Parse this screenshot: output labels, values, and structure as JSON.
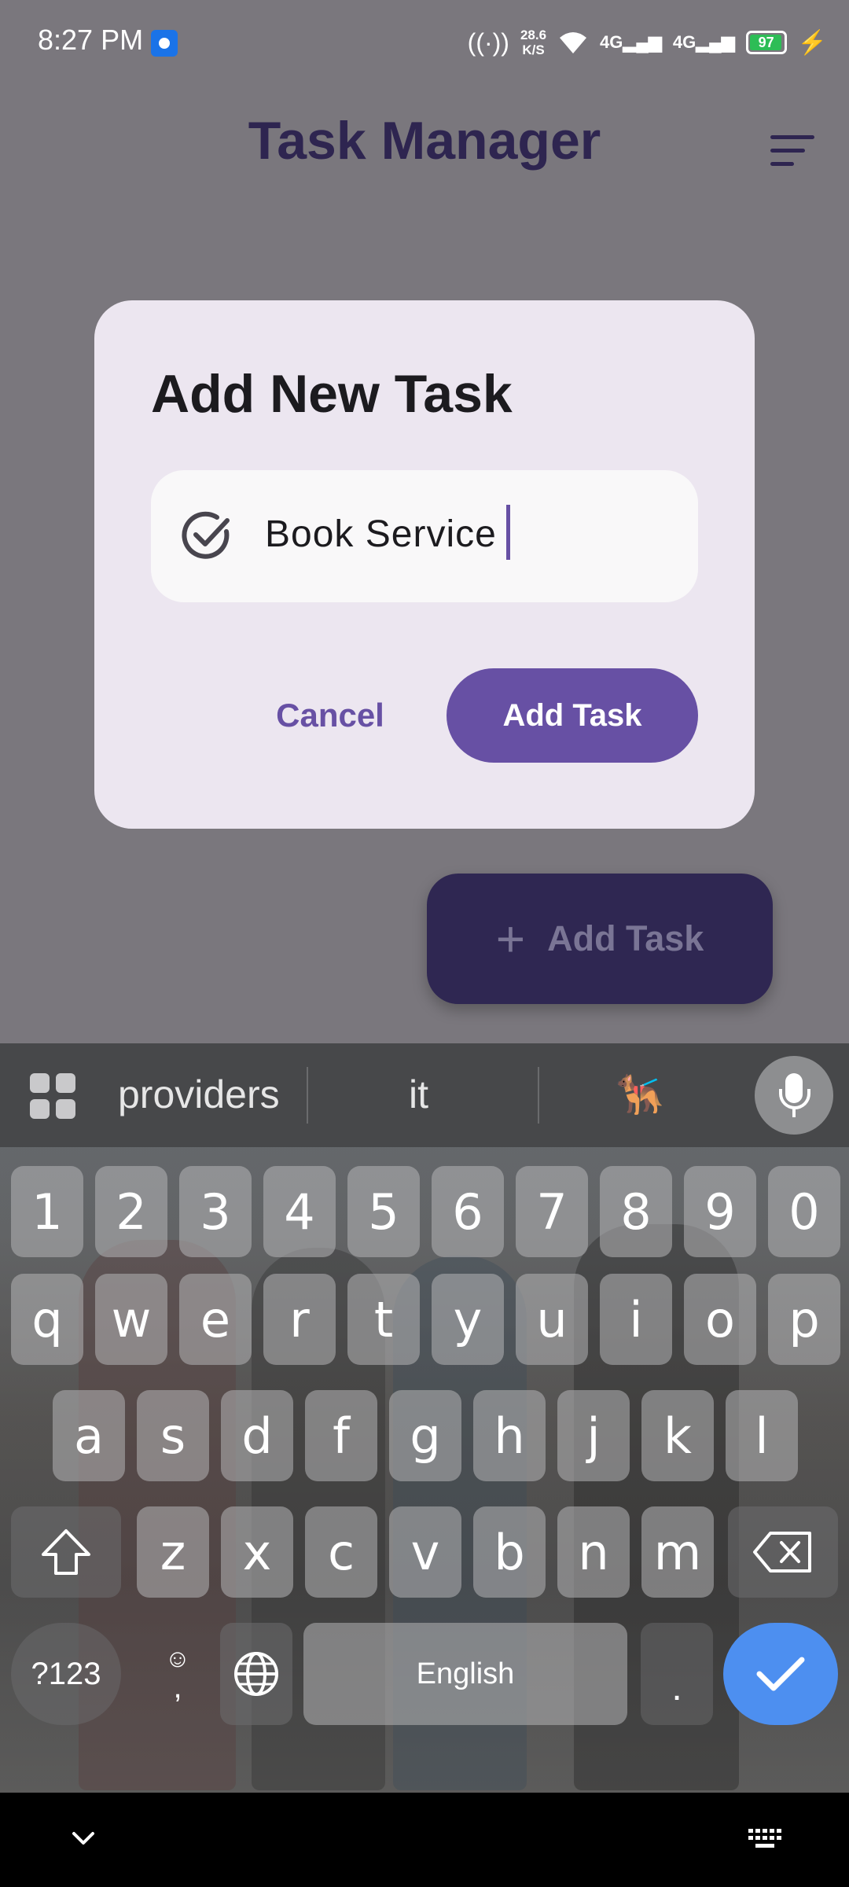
{
  "status_bar": {
    "time": "8:27 PM",
    "hotspot_count": "3",
    "speed_value": "28.6",
    "speed_unit": "K/S",
    "net1": "4G",
    "net2": "4G",
    "battery": "97"
  },
  "app": {
    "title": "Task Manager"
  },
  "dialog": {
    "title": "Add New Task",
    "input_value": "Book Service",
    "cancel_label": "Cancel",
    "add_label": "Add Task"
  },
  "fab": {
    "label": "Add Task"
  },
  "keyboard": {
    "suggestions": [
      "providers",
      "it",
      "🐕‍🦺"
    ],
    "number_row": [
      "1",
      "2",
      "3",
      "4",
      "5",
      "6",
      "7",
      "8",
      "9",
      "0"
    ],
    "row1": [
      "q",
      "w",
      "e",
      "r",
      "t",
      "y",
      "u",
      "i",
      "o",
      "p"
    ],
    "row2": [
      "a",
      "s",
      "d",
      "f",
      "g",
      "h",
      "j",
      "k",
      "l"
    ],
    "row3": [
      "z",
      "x",
      "c",
      "v",
      "b",
      "n",
      "m"
    ],
    "symbols_label": "?123",
    "emoji_glyph": "☺",
    "comma": ",",
    "space_label": "English",
    "period": "."
  },
  "colors": {
    "primary": "#6750a4",
    "title": "#2e2550",
    "dialog_bg": "#ece6f0",
    "enter": "#4d8ff0"
  }
}
